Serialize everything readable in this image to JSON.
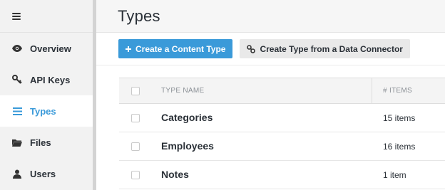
{
  "sidebar": {
    "items": [
      {
        "label": "Overview",
        "icon": "eye-icon"
      },
      {
        "label": "API Keys",
        "icon": "key-icon"
      },
      {
        "label": "Types",
        "icon": "list-icon",
        "active": true
      },
      {
        "label": "Files",
        "icon": "folder-icon"
      },
      {
        "label": "Users",
        "icon": "user-icon"
      }
    ]
  },
  "header": {
    "title": "Types"
  },
  "toolbar": {
    "create_content_type": "Create a Content Type",
    "create_from_connector": "Create Type from a Data Connector"
  },
  "table": {
    "columns": [
      "TYPE NAME",
      "# ITEMS"
    ],
    "rows": [
      {
        "name": "Categories",
        "items": "15 items"
      },
      {
        "name": "Employees",
        "items": "16 items"
      },
      {
        "name": "Notes",
        "items": "1 item"
      }
    ]
  },
  "colors": {
    "accent": "#3a9ad9",
    "sidebar_bg": "#f2f2f2",
    "text": "#2b3138"
  }
}
